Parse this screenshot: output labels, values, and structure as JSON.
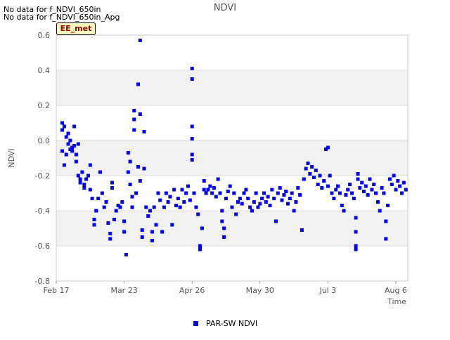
{
  "notes": [
    "No data for f_NDVI_650in",
    "No data for f_NDVI_650in_Apg"
  ],
  "badge": "EE_met",
  "colors": {
    "series": "#0000ff",
    "band": "#f2f2f2",
    "grid": "#dddddd",
    "text": "#555555"
  },
  "chart_data": {
    "type": "scatter",
    "title": "NDVI",
    "xlabel": "Time",
    "ylabel": "NDVI",
    "ylim": [
      -0.8,
      0.6
    ],
    "yticks": [
      "0.6",
      "0.4",
      "0.2",
      "0.0",
      "-0.2",
      "-0.4",
      "-0.6",
      "-0.8"
    ],
    "xlim": [
      "2019-02-17",
      "2019-08-12"
    ],
    "xticks": [
      {
        "date": "2019-02-17",
        "label": "Feb 17"
      },
      {
        "date": "2019-03-23",
        "label": "Mar 23"
      },
      {
        "date": "2019-04-26",
        "label": "Apr 26"
      },
      {
        "date": "2019-05-30",
        "label": "May 30"
      },
      {
        "date": "2019-07-03",
        "label": "Jul 3"
      },
      {
        "date": "2019-08-06",
        "label": "Aug 6"
      }
    ],
    "legend_position": "bottom",
    "series": [
      {
        "name": "PAR-SW NDVI",
        "color": "#0000ff",
        "points": [
          [
            "2019-02-20",
            0.1
          ],
          [
            "2019-02-20",
            0.06
          ],
          [
            "2019-02-20",
            -0.06
          ],
          [
            "2019-02-21",
            0.08
          ],
          [
            "2019-02-21",
            -0.14
          ],
          [
            "2019-02-22",
            0.02
          ],
          [
            "2019-02-22",
            -0.08
          ],
          [
            "2019-02-23",
            0.04
          ],
          [
            "2019-02-23",
            -0.02
          ],
          [
            "2019-02-24",
            0.0
          ],
          [
            "2019-02-24",
            -0.05
          ],
          [
            "2019-02-25",
            -0.04
          ],
          [
            "2019-02-25",
            -0.06
          ],
          [
            "2019-02-26",
            0.08
          ],
          [
            "2019-02-26",
            -0.03
          ],
          [
            "2019-02-27",
            -0.08
          ],
          [
            "2019-02-27",
            -0.12
          ],
          [
            "2019-02-28",
            -0.02
          ],
          [
            "2019-02-28",
            -0.2
          ],
          [
            "2019-03-01",
            -0.22
          ],
          [
            "2019-03-01",
            -0.24
          ],
          [
            "2019-03-02",
            -0.18
          ],
          [
            "2019-03-03",
            -0.25
          ],
          [
            "2019-03-03",
            -0.27
          ],
          [
            "2019-03-04",
            -0.22
          ],
          [
            "2019-03-05",
            -0.2
          ],
          [
            "2019-03-06",
            -0.14
          ],
          [
            "2019-03-06",
            -0.28
          ],
          [
            "2019-03-07",
            -0.33
          ],
          [
            "2019-03-08",
            -0.45
          ],
          [
            "2019-03-08",
            -0.48
          ],
          [
            "2019-03-09",
            -0.4
          ],
          [
            "2019-03-10",
            -0.33
          ],
          [
            "2019-03-11",
            -0.18
          ],
          [
            "2019-03-12",
            -0.3
          ],
          [
            "2019-03-13",
            -0.38
          ],
          [
            "2019-03-14",
            -0.35
          ],
          [
            "2019-03-15",
            -0.47
          ],
          [
            "2019-03-16",
            -0.53
          ],
          [
            "2019-03-16",
            -0.56
          ],
          [
            "2019-03-17",
            -0.27
          ],
          [
            "2019-03-17",
            -0.24
          ],
          [
            "2019-03-18",
            -0.45
          ],
          [
            "2019-03-19",
            -0.4
          ],
          [
            "2019-03-20",
            -0.37
          ],
          [
            "2019-03-21",
            -0.38
          ],
          [
            "2019-03-22",
            -0.35
          ],
          [
            "2019-03-23",
            -0.46
          ],
          [
            "2019-03-23",
            -0.52
          ],
          [
            "2019-03-24",
            -0.65
          ],
          [
            "2019-03-25",
            -0.07
          ],
          [
            "2019-03-25",
            -0.18
          ],
          [
            "2019-03-26",
            -0.12
          ],
          [
            "2019-03-26",
            -0.25
          ],
          [
            "2019-03-27",
            -0.32
          ],
          [
            "2019-03-27",
            -0.38
          ],
          [
            "2019-03-28",
            0.17
          ],
          [
            "2019-03-28",
            0.12
          ],
          [
            "2019-03-28",
            0.06
          ],
          [
            "2019-03-29",
            -0.3
          ],
          [
            "2019-03-30",
            0.32
          ],
          [
            "2019-03-30",
            -0.15
          ],
          [
            "2019-03-31",
            0.57
          ],
          [
            "2019-03-31",
            0.15
          ],
          [
            "2019-03-31",
            -0.23
          ],
          [
            "2019-04-01",
            -0.51
          ],
          [
            "2019-04-01",
            -0.55
          ],
          [
            "2019-04-02",
            0.05
          ],
          [
            "2019-04-02",
            -0.16
          ],
          [
            "2019-04-03",
            -0.38
          ],
          [
            "2019-04-04",
            -0.43
          ],
          [
            "2019-04-05",
            -0.4
          ],
          [
            "2019-04-06",
            -0.57
          ],
          [
            "2019-04-06",
            -0.52
          ],
          [
            "2019-04-07",
            -0.38
          ],
          [
            "2019-04-08",
            -0.48
          ],
          [
            "2019-04-09",
            -0.3
          ],
          [
            "2019-04-10",
            -0.34
          ],
          [
            "2019-04-11",
            -0.52
          ],
          [
            "2019-04-12",
            -0.38
          ],
          [
            "2019-04-13",
            -0.3
          ],
          [
            "2019-04-14",
            -0.35
          ],
          [
            "2019-04-15",
            -0.32
          ],
          [
            "2019-04-16",
            -0.48
          ],
          [
            "2019-04-17",
            -0.28
          ],
          [
            "2019-04-18",
            -0.37
          ],
          [
            "2019-04-19",
            -0.33
          ],
          [
            "2019-04-20",
            -0.38
          ],
          [
            "2019-04-21",
            -0.28
          ],
          [
            "2019-04-22",
            -0.35
          ],
          [
            "2019-04-23",
            -0.3
          ],
          [
            "2019-04-24",
            -0.26
          ],
          [
            "2019-04-25",
            -0.34
          ],
          [
            "2019-04-26",
            0.41
          ],
          [
            "2019-04-26",
            0.35
          ],
          [
            "2019-04-26",
            0.08
          ],
          [
            "2019-04-26",
            0.01
          ],
          [
            "2019-04-26",
            -0.08
          ],
          [
            "2019-04-26",
            -0.11
          ],
          [
            "2019-04-27",
            -0.3
          ],
          [
            "2019-04-28",
            -0.38
          ],
          [
            "2019-04-29",
            -0.42
          ],
          [
            "2019-04-30",
            -0.6
          ],
          [
            "2019-04-30",
            -0.62
          ],
          [
            "2019-05-01",
            -0.5
          ],
          [
            "2019-05-02",
            -0.28
          ],
          [
            "2019-05-02",
            -0.23
          ],
          [
            "2019-05-03",
            -0.3
          ],
          [
            "2019-05-04",
            -0.28
          ],
          [
            "2019-05-05",
            -0.26
          ],
          [
            "2019-05-06",
            -0.3
          ],
          [
            "2019-05-07",
            -0.27
          ],
          [
            "2019-05-08",
            -0.32
          ],
          [
            "2019-05-09",
            -0.22
          ],
          [
            "2019-05-10",
            -0.3
          ],
          [
            "2019-05-11",
            -0.4
          ],
          [
            "2019-05-11",
            -0.46
          ],
          [
            "2019-05-12",
            -0.5
          ],
          [
            "2019-05-12",
            -0.55
          ],
          [
            "2019-05-13",
            -0.33
          ],
          [
            "2019-05-14",
            -0.29
          ],
          [
            "2019-05-15",
            -0.26
          ],
          [
            "2019-05-16",
            -0.38
          ],
          [
            "2019-05-17",
            -0.3
          ],
          [
            "2019-05-18",
            -0.42
          ],
          [
            "2019-05-19",
            -0.35
          ],
          [
            "2019-05-20",
            -0.33
          ],
          [
            "2019-05-21",
            -0.36
          ],
          [
            "2019-05-22",
            -0.3
          ],
          [
            "2019-05-23",
            -0.28
          ],
          [
            "2019-05-24",
            -0.33
          ],
          [
            "2019-05-25",
            -0.38
          ],
          [
            "2019-05-26",
            -0.4
          ],
          [
            "2019-05-27",
            -0.35
          ],
          [
            "2019-05-28",
            -0.3
          ],
          [
            "2019-05-29",
            -0.38
          ],
          [
            "2019-05-30",
            -0.36
          ],
          [
            "2019-05-31",
            -0.33
          ],
          [
            "2019-06-01",
            -0.3
          ],
          [
            "2019-06-02",
            -0.35
          ],
          [
            "2019-06-03",
            -0.32
          ],
          [
            "2019-06-04",
            -0.37
          ],
          [
            "2019-06-05",
            -0.28
          ],
          [
            "2019-06-06",
            -0.33
          ],
          [
            "2019-06-07",
            -0.46
          ],
          [
            "2019-06-08",
            -0.3
          ],
          [
            "2019-06-09",
            -0.27
          ],
          [
            "2019-06-10",
            -0.34
          ],
          [
            "2019-06-11",
            -0.31
          ],
          [
            "2019-06-12",
            -0.29
          ],
          [
            "2019-06-13",
            -0.36
          ],
          [
            "2019-06-14",
            -0.33
          ],
          [
            "2019-06-15",
            -0.3
          ],
          [
            "2019-06-16",
            -0.4
          ],
          [
            "2019-06-17",
            -0.35
          ],
          [
            "2019-06-18",
            -0.27
          ],
          [
            "2019-06-19",
            -0.31
          ],
          [
            "2019-06-20",
            -0.51
          ],
          [
            "2019-06-21",
            -0.22
          ],
          [
            "2019-06-22",
            -0.16
          ],
          [
            "2019-06-23",
            -0.13
          ],
          [
            "2019-06-24",
            -0.19
          ],
          [
            "2019-06-25",
            -0.15
          ],
          [
            "2019-06-26",
            -0.21
          ],
          [
            "2019-06-27",
            -0.17
          ],
          [
            "2019-06-28",
            -0.25
          ],
          [
            "2019-06-29",
            -0.2
          ],
          [
            "2019-06-30",
            -0.27
          ],
          [
            "2019-07-01",
            -0.23
          ],
          [
            "2019-07-02",
            -0.05
          ],
          [
            "2019-07-03",
            -0.04
          ],
          [
            "2019-07-03",
            -0.26
          ],
          [
            "2019-07-04",
            -0.2
          ],
          [
            "2019-07-05",
            -0.3
          ],
          [
            "2019-07-06",
            -0.33
          ],
          [
            "2019-07-07",
            -0.28
          ],
          [
            "2019-07-08",
            -0.26
          ],
          [
            "2019-07-09",
            -0.3
          ],
          [
            "2019-07-10",
            -0.37
          ],
          [
            "2019-07-11",
            -0.4
          ],
          [
            "2019-07-12",
            -0.31
          ],
          [
            "2019-07-13",
            -0.28
          ],
          [
            "2019-07-14",
            -0.25
          ],
          [
            "2019-07-15",
            -0.3
          ],
          [
            "2019-07-16",
            -0.33
          ],
          [
            "2019-07-17",
            -0.44
          ],
          [
            "2019-07-17",
            -0.52
          ],
          [
            "2019-07-17",
            -0.6
          ],
          [
            "2019-07-17",
            -0.62
          ],
          [
            "2019-07-18",
            -0.19
          ],
          [
            "2019-07-18",
            -0.22
          ],
          [
            "2019-07-19",
            -0.27
          ],
          [
            "2019-07-20",
            -0.24
          ],
          [
            "2019-07-21",
            -0.29
          ],
          [
            "2019-07-22",
            -0.26
          ],
          [
            "2019-07-23",
            -0.31
          ],
          [
            "2019-07-24",
            -0.22
          ],
          [
            "2019-07-25",
            -0.28
          ],
          [
            "2019-07-26",
            -0.25
          ],
          [
            "2019-07-27",
            -0.3
          ],
          [
            "2019-07-28",
            -0.35
          ],
          [
            "2019-07-29",
            -0.4
          ],
          [
            "2019-07-30",
            -0.27
          ],
          [
            "2019-07-31",
            -0.3
          ],
          [
            "2019-08-01",
            -0.46
          ],
          [
            "2019-08-01",
            -0.56
          ],
          [
            "2019-08-02",
            -0.37
          ],
          [
            "2019-08-03",
            -0.22
          ],
          [
            "2019-08-04",
            -0.25
          ],
          [
            "2019-08-05",
            -0.2
          ],
          [
            "2019-08-06",
            -0.28
          ],
          [
            "2019-08-07",
            -0.23
          ],
          [
            "2019-08-08",
            -0.26
          ],
          [
            "2019-08-09",
            -0.3
          ],
          [
            "2019-08-10",
            -0.24
          ],
          [
            "2019-08-11",
            -0.28
          ]
        ]
      }
    ]
  }
}
